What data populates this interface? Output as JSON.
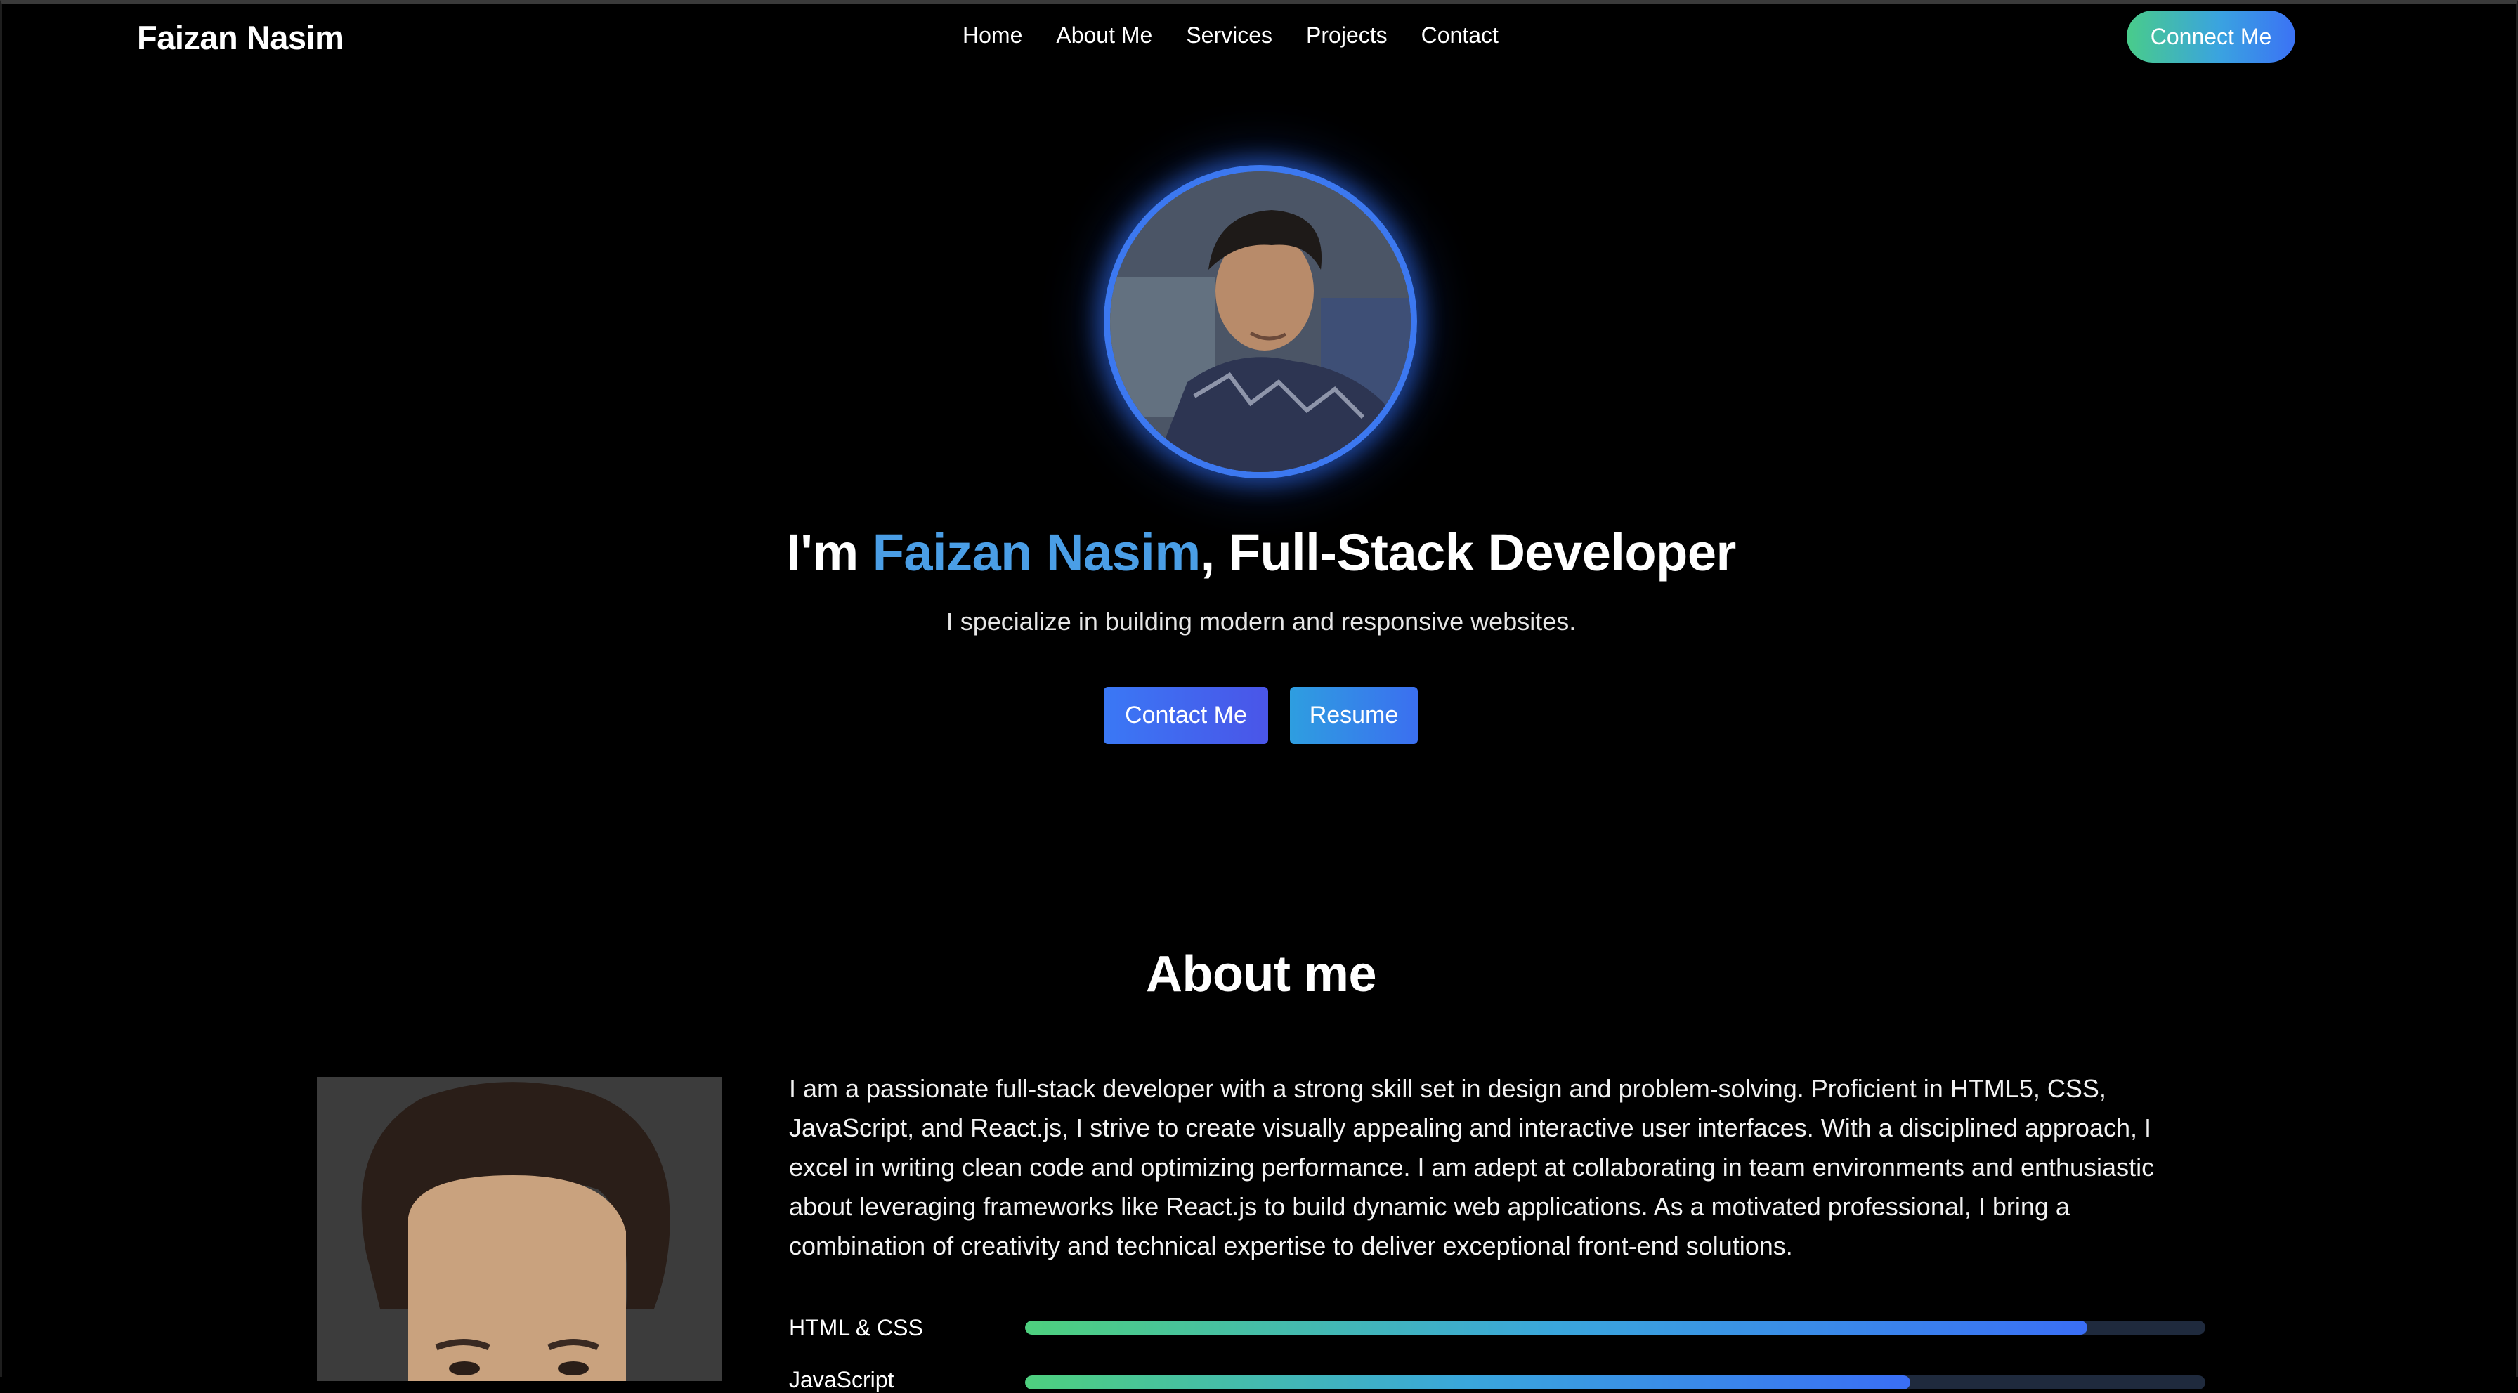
{
  "navbar": {
    "brand": "Faizan Nasim",
    "links": [
      "Home",
      "About Me",
      "Services",
      "Projects",
      "Contact"
    ],
    "cta_label": "Connect Me"
  },
  "hero": {
    "title_prefix": "I'm ",
    "title_name": "Faizan Nasim",
    "title_suffix": ", Full-Stack Developer",
    "subtitle": "I specialize in building modern and responsive websites.",
    "contact_button": "Contact Me",
    "resume_button": "Resume"
  },
  "about": {
    "title": "About me",
    "paragraph": "I am a passionate full-stack developer with a strong skill set in design and problem-solving. Proficient in HTML5, CSS, JavaScript, and React.js, I strive to create visually appealing and interactive user interfaces. With a disciplined approach, I excel in writing clean code and optimizing performance. I am adept at collaborating in team environments and enthusiastic about leveraging frameworks like React.js to build dynamic web applications. As a motivated professional, I bring a combination of creativity and technical expertise to deliver exceptional front-end solutions.",
    "skills": [
      {
        "label": "HTML & CSS",
        "percent": 90
      },
      {
        "label": "JavaScript",
        "percent": 75
      }
    ]
  },
  "colors": {
    "accent_name": "#4a9ee6",
    "avatar_ring": "#3c78f0",
    "background": "#000000"
  }
}
